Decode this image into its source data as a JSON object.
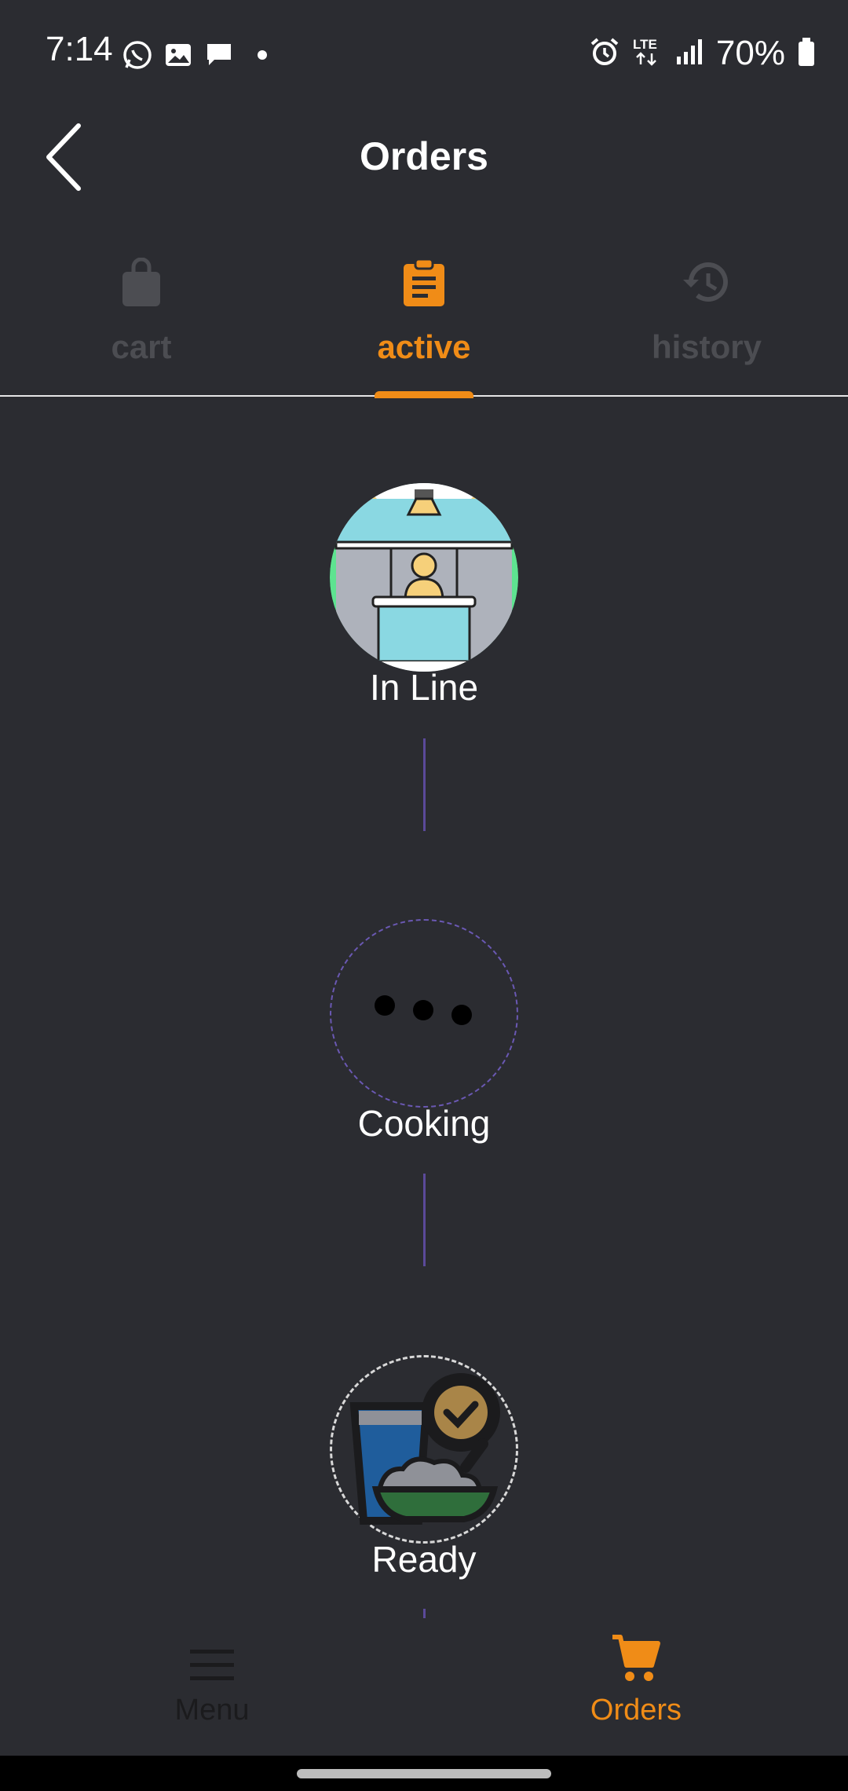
{
  "status_bar": {
    "time": "7:14",
    "battery_text": "70%",
    "icons_left": [
      "whatsapp-icon",
      "gallery-icon",
      "message-icon",
      "dot-icon"
    ],
    "icons_right": [
      "alarm-icon",
      "lte-icon",
      "signal-icon",
      "battery-icon"
    ]
  },
  "header": {
    "title": "Orders"
  },
  "tabs": [
    {
      "label": "cart",
      "icon": "shopping-bag-icon",
      "active": false
    },
    {
      "label": "active",
      "icon": "clipboard-icon",
      "active": true
    },
    {
      "label": "history",
      "icon": "history-icon",
      "active": false
    }
  ],
  "steps": [
    {
      "label": "In Line",
      "icon": "counter-illustration-icon"
    },
    {
      "label": "Cooking",
      "icon": "dots-loading-icon"
    },
    {
      "label": "Ready",
      "icon": "food-ready-icon"
    }
  ],
  "bottom_nav": {
    "menu_label": "Menu",
    "orders_label": "Orders"
  },
  "colors": {
    "background": "#2b2c31",
    "accent": "#f08c17",
    "inactive": "#4c4d52",
    "connector": "#5b4a9a"
  }
}
